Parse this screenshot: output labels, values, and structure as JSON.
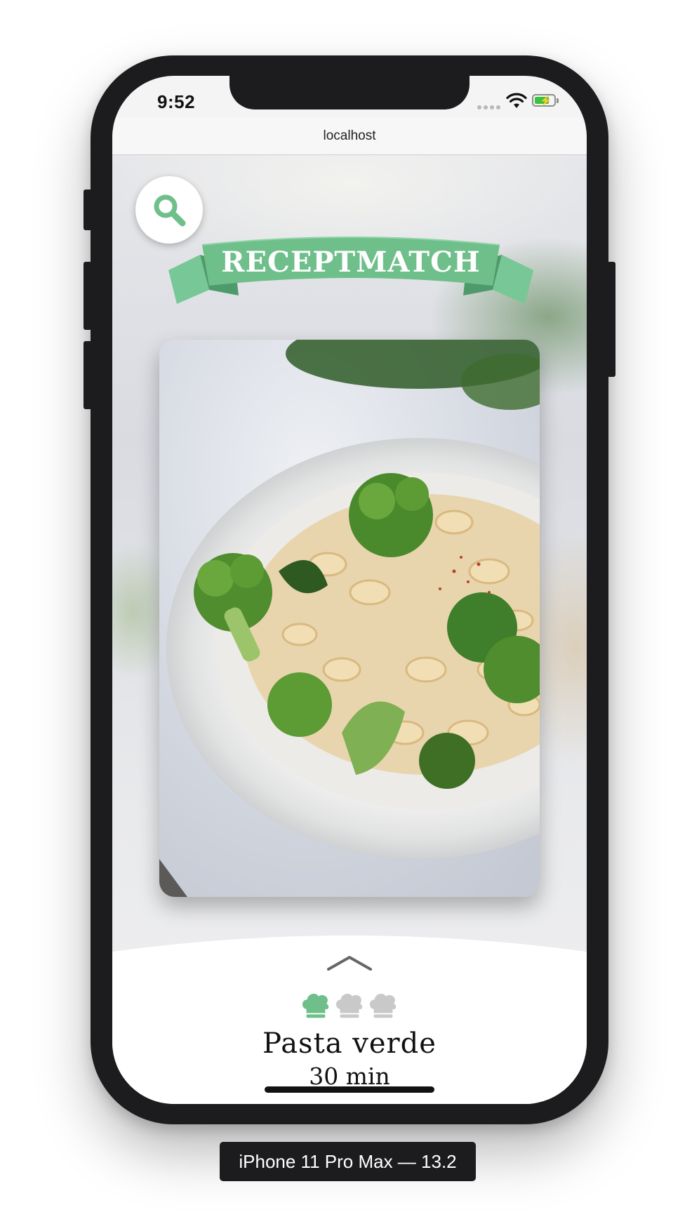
{
  "status_bar": {
    "time": "9:52",
    "battery_icon": "battery-charging-icon",
    "wifi_icon": "wifi-icon"
  },
  "browser": {
    "address": "localhost"
  },
  "app": {
    "brand": "RECEPTMATCH",
    "search_icon": "search-icon",
    "brand_color": "#6fbf8b",
    "recipe": {
      "name": "Pasta verde",
      "duration": "30 min",
      "difficulty_level": 1,
      "difficulty_max": 3,
      "image": "pasta-broccoli-plate"
    },
    "expand_icon": "chevron-up-icon"
  },
  "simulator": {
    "label": "iPhone 11 Pro Max — 13.2"
  }
}
